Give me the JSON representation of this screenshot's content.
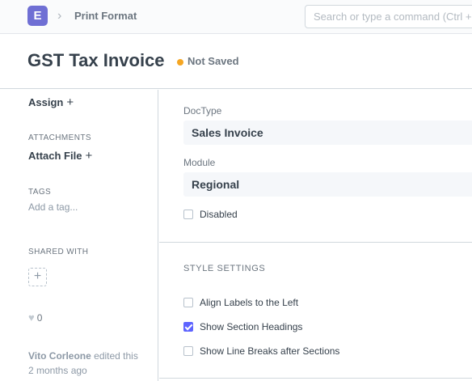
{
  "navbar": {
    "logo_letter": "E",
    "breadcrumb_separator": "›",
    "breadcrumb": "Print Format",
    "search_placeholder": "Search or type a command (Ctrl + G)"
  },
  "header": {
    "title": "GST Tax Invoice",
    "status": "Not Saved",
    "status_color": "#f5a623"
  },
  "sidebar": {
    "assign_label": "Assign",
    "attachments_label": "ATTACHMENTS",
    "attach_file_label": "Attach File",
    "tags_label": "TAGS",
    "add_tag_label": "Add a tag...",
    "shared_with_label": "SHARED WITH",
    "likes": "0",
    "activity_user": "Vito Corleone",
    "activity_action": "edited this",
    "activity_time": "2 months ago"
  },
  "form": {
    "doctype_label": "DocType",
    "doctype_value": "Sales Invoice",
    "module_label": "Module",
    "module_value": "Regional",
    "disabled_label": "Disabled",
    "disabled_checked": false,
    "style_settings_label": "STYLE SETTINGS",
    "options": [
      {
        "label": "Align Labels to the Left",
        "checked": false
      },
      {
        "label": "Show Section Headings",
        "checked": true
      },
      {
        "label": "Show Line Breaks after Sections",
        "checked": false
      }
    ]
  },
  "colors": {
    "accent": "#5e64ff",
    "logo": "#6f6fd4"
  }
}
